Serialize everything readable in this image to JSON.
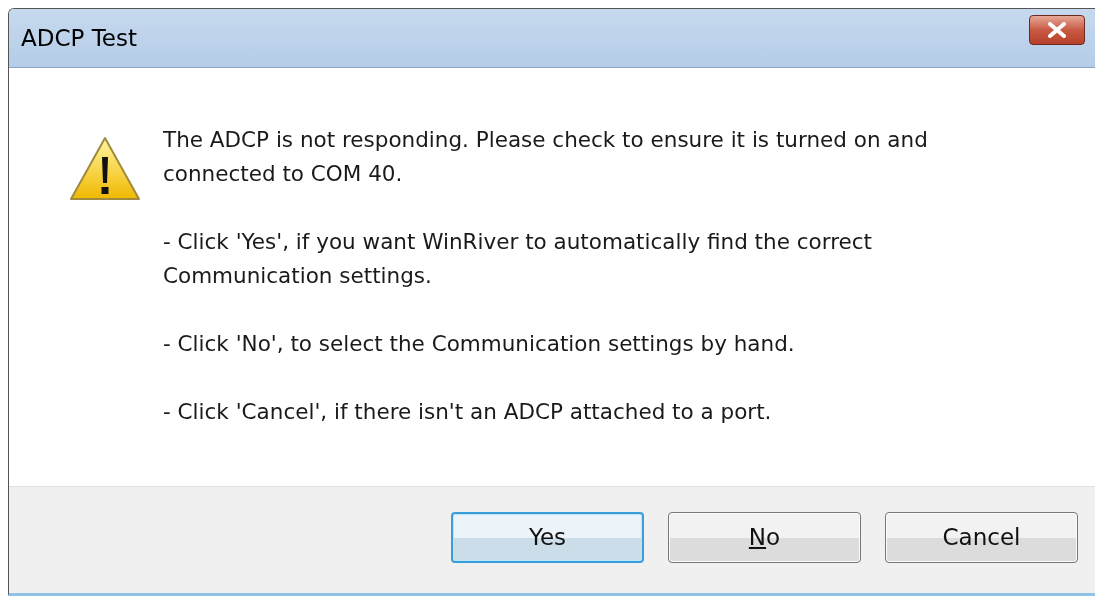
{
  "window": {
    "title": "ADCP Test"
  },
  "message": [
    "The ADCP is not responding. Please check to ensure it is turned on and connected to COM 40.",
    "- Click 'Yes', if you want WinRiver to automatically find the correct Communication settings.",
    "- Click 'No', to select the Communication settings by hand.",
    "- Click 'Cancel', if there isn't an ADCP attached to a port."
  ],
  "buttons": [
    {
      "label": "Yes",
      "selected": true,
      "mnemonic_underlined": false
    },
    {
      "label": "No",
      "selected": false,
      "mnemonic_underlined": true
    },
    {
      "label": "Cancel",
      "selected": false,
      "mnemonic_underlined": false
    }
  ]
}
